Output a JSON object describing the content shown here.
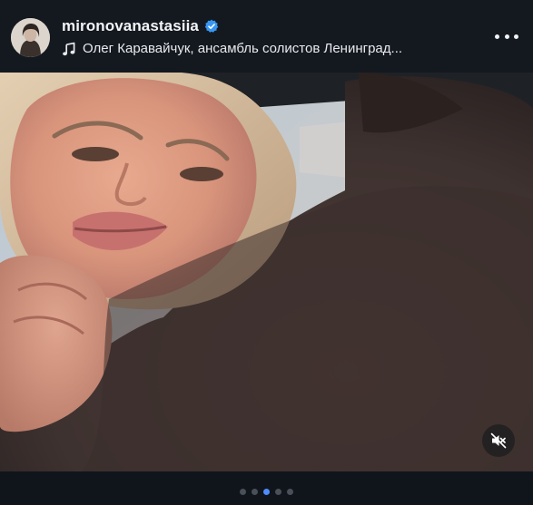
{
  "post": {
    "username": "mironovanastasiia",
    "verified": true,
    "audio": "Олег Каравайчук, ансамбль солистов Ленинград..."
  },
  "icons": {
    "avatar": "avatar",
    "verified": "verified-badge-icon",
    "music": "music-note-icon",
    "more": "more-options-icon",
    "mute": "speaker-muted-icon"
  },
  "colors": {
    "background": "#10151c",
    "verified_badge": "#3897f0",
    "active_dot": "#4f8cff",
    "inactive_dot": "#4a5058"
  },
  "carousel": {
    "total": 5,
    "active_index": 2
  },
  "media": {
    "type": "photo",
    "muted": true
  }
}
